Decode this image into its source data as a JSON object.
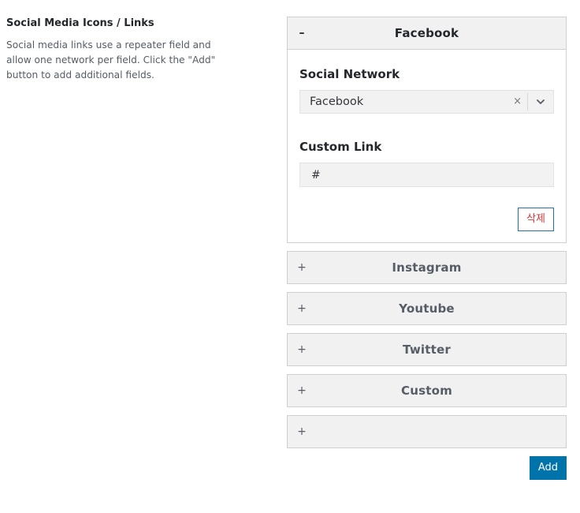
{
  "section": {
    "title": "Social Media Icons / Links",
    "description": "Social media links use a repeater field and allow one network per field. Click the \"Add\" button to add additional fields."
  },
  "rows": [
    {
      "title": "Facebook",
      "toggle": "–",
      "network_label": "Social Network",
      "network_value": "Facebook",
      "clear_glyph": "×",
      "link_label": "Custom Link",
      "link_value": "#",
      "delete_label": "삭제"
    },
    {
      "title": "Instagram",
      "toggle": "+"
    },
    {
      "title": "Youtube",
      "toggle": "+"
    },
    {
      "title": "Twitter",
      "toggle": "+"
    },
    {
      "title": "Custom",
      "toggle": "+"
    },
    {
      "title": "",
      "toggle": "+"
    }
  ],
  "add_label": "Add",
  "colors": {
    "primary": "#0073aa",
    "danger_text": "#d63638",
    "header_bg": "#f1f1f1",
    "border": "#cfcfcf"
  },
  "icons": {
    "select_arrow": "chevron-down-icon",
    "select_clear": "close-icon"
  }
}
